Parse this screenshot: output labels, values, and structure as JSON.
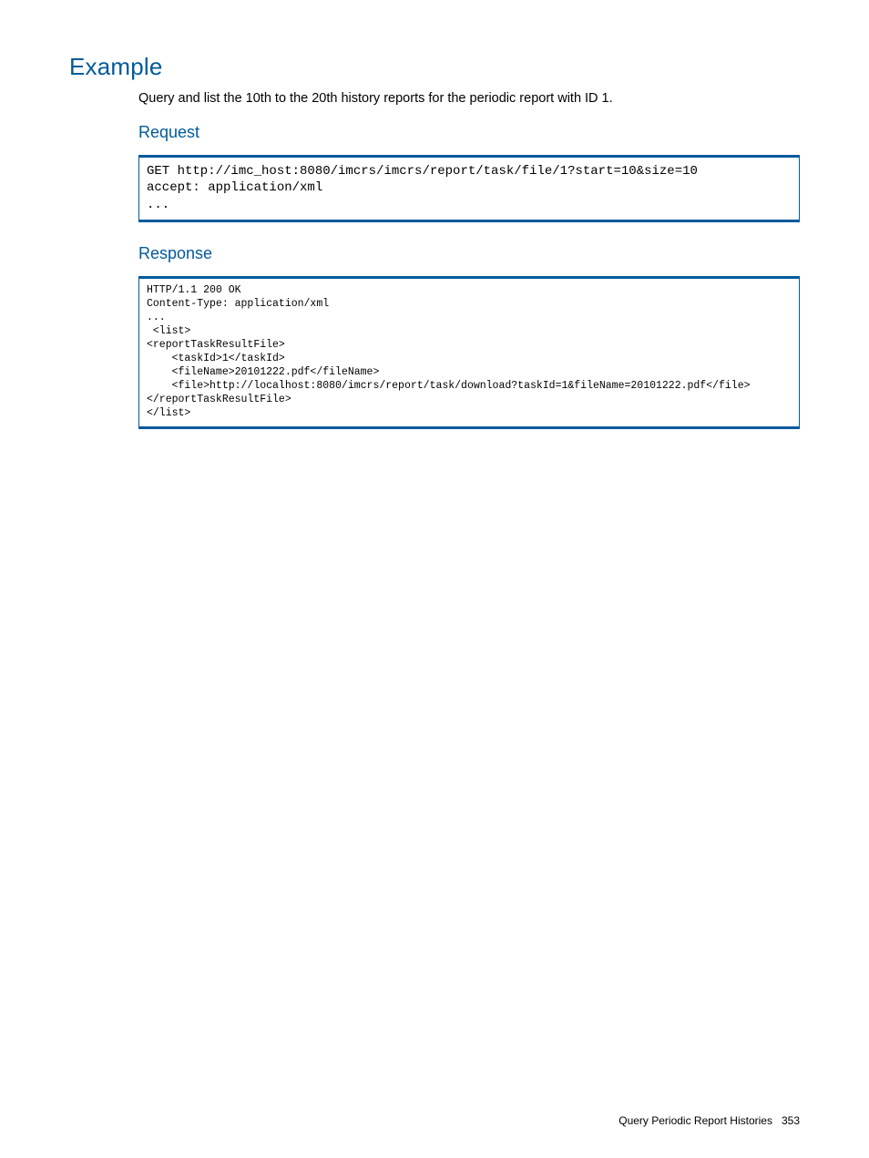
{
  "heading": "Example",
  "intro": "Query and list the 10th to the 20th history reports for the periodic report with ID 1.",
  "sections": {
    "request": {
      "title": "Request",
      "code": "GET http://imc_host:8080/imcrs/imcrs/report/task/file/1?start=10&size=10\naccept: application/xml\n..."
    },
    "response": {
      "title": "Response",
      "code": "HTTP/1.1 200 OK\nContent-Type: application/xml\n...\n <list>\n<reportTaskResultFile>\n    <taskId>1</taskId>\n    <fileName>20101222.pdf</fileName>\n    <file>http://localhost:8080/imcrs/report/task/download?taskId=1&fileName=20101222.pdf</file>\n</reportTaskResultFile>\n</list>"
    }
  },
  "footer": {
    "section_name": "Query Periodic Report Histories",
    "page_number": "353"
  }
}
